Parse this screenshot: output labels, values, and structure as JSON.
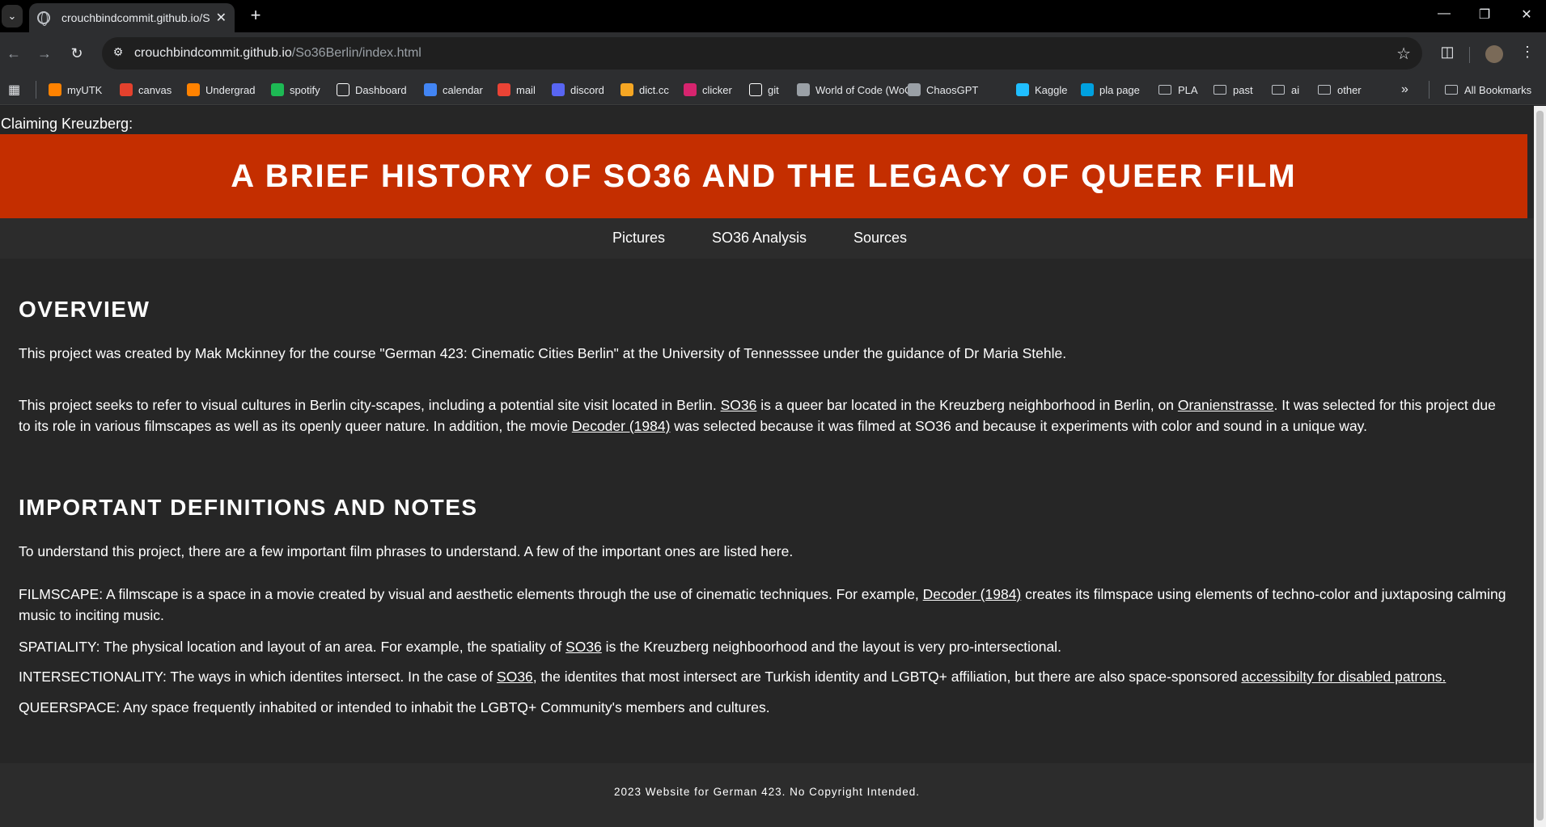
{
  "browser": {
    "tab_title": "crouchbindcommit.github.io/So",
    "url_host": "crouchbindcommit.github.io",
    "url_path": "/So36Berlin/index.html",
    "bookmarks": [
      {
        "label": "myUTK",
        "icon": "utk-icon",
        "color": "#ff8200"
      },
      {
        "label": "canvas",
        "icon": "canvas-icon",
        "color": "#e4412d"
      },
      {
        "label": "Undergrad",
        "icon": "tennessee-t-icon",
        "color": "#ff8200"
      },
      {
        "label": "spotify",
        "icon": "spotify-icon",
        "color": "#1db954"
      },
      {
        "label": "Dashboard",
        "icon": "notion-icon",
        "color": "#ffffff"
      },
      {
        "label": "calendar",
        "icon": "calendar-icon",
        "color": "#4285f4"
      },
      {
        "label": "mail",
        "icon": "gmail-icon",
        "color": "#ea4335"
      },
      {
        "label": "discord",
        "icon": "discord-icon",
        "color": "#5865f2"
      },
      {
        "label": "dict.cc",
        "icon": "dictcc-icon",
        "color": "#f5a623"
      },
      {
        "label": "clicker",
        "icon": "ps-icon",
        "color": "#d6246e"
      },
      {
        "label": "git",
        "icon": "github-icon",
        "color": "#ffffff"
      },
      {
        "label": "World of Code (WoC)",
        "icon": "woc-icon",
        "color": "#9aa0a6"
      },
      {
        "label": "ChaosGPT",
        "icon": "chaosgpt-icon",
        "color": "#9aa0a6"
      },
      {
        "label": "Kaggle",
        "icon": "kaggle-icon",
        "color": "#20beff"
      },
      {
        "label": "pla page",
        "icon": "salesforce-icon",
        "color": "#00a1e0"
      },
      {
        "label": "PLA",
        "icon": "folder-icon"
      },
      {
        "label": "past",
        "icon": "folder-icon"
      },
      {
        "label": "ai",
        "icon": "folder-icon"
      },
      {
        "label": "other",
        "icon": "folder-icon"
      }
    ],
    "all_bookmarks": "All Bookmarks"
  },
  "site": {
    "kicker": "Claiming Kreuzberg:",
    "banner_title": "A BRIEF HISTORY OF SO36 AND THE LEGACY OF QUEER FILM",
    "banner_color": "#c42e00",
    "nav": [
      "Pictures",
      "SO36 Analysis",
      "Sources"
    ],
    "overview": {
      "heading": "OVERVIEW",
      "p1": "This project was created by Mak Mckinney for the course \"German 423: Cinematic Cities Berlin\" at the University of Tennesssee under the guidance of Dr Maria Stehle.",
      "p2_a": "This project seeks to refer to visual cultures in Berlin city-scapes, including a potential site visit located in Berlin. ",
      "p2_link1": "SO36",
      "p2_b": " is a queer bar located in the Kreuzberg neighborhood in Berlin, on ",
      "p2_link2": "Oranienstrasse",
      "p2_c": ". It was selected for this project due to its role in various filmscapes as well as its openly queer nature. In addition, the movie ",
      "p2_link3": "Decoder (1984)",
      "p2_d": " was selected because it was filmed at SO36 and because it experiments with color and sound in a unique way."
    },
    "definitions": {
      "heading": "IMPORTANT DEFINITIONS AND NOTES",
      "intro": "To understand this project, there are a few important film phrases to understand. A few of the important ones are listed here.",
      "filmscape_a": "FILMSCAPE: A filmscape is a space in a movie created by visual and aesthetic elements through the use of cinematic techniques. For example, ",
      "filmscape_link": "Decoder (1984)",
      "filmscape_b": " creates its filmspace using elements of techno-color and juxtaposing calming music to inciting music.",
      "spatiality_a": "SPATIALITY: The physical location and layout of an area. For example, the spatiality of ",
      "spatiality_link": "SO36",
      "spatiality_b": " is the Kreuzberg neighboorhood and the layout is very pro-intersectional.",
      "intersect_a": "INTERSECTIONALITY: The ways in which identites intersect. In the case of ",
      "intersect_link1": "SO36",
      "intersect_b": ", the identites that most intersect are Turkish identity and LGBTQ+ affiliation, but there are also space-sponsored ",
      "intersect_link2": "accessibilty for disabled patrons.",
      "queerspace": "QUEERSPACE: Any space frequently inhabited or intended to inhabit the LGBTQ+ Community's members and cultures."
    },
    "footer": "2023 Website for German 423. No Copyright Intended."
  }
}
